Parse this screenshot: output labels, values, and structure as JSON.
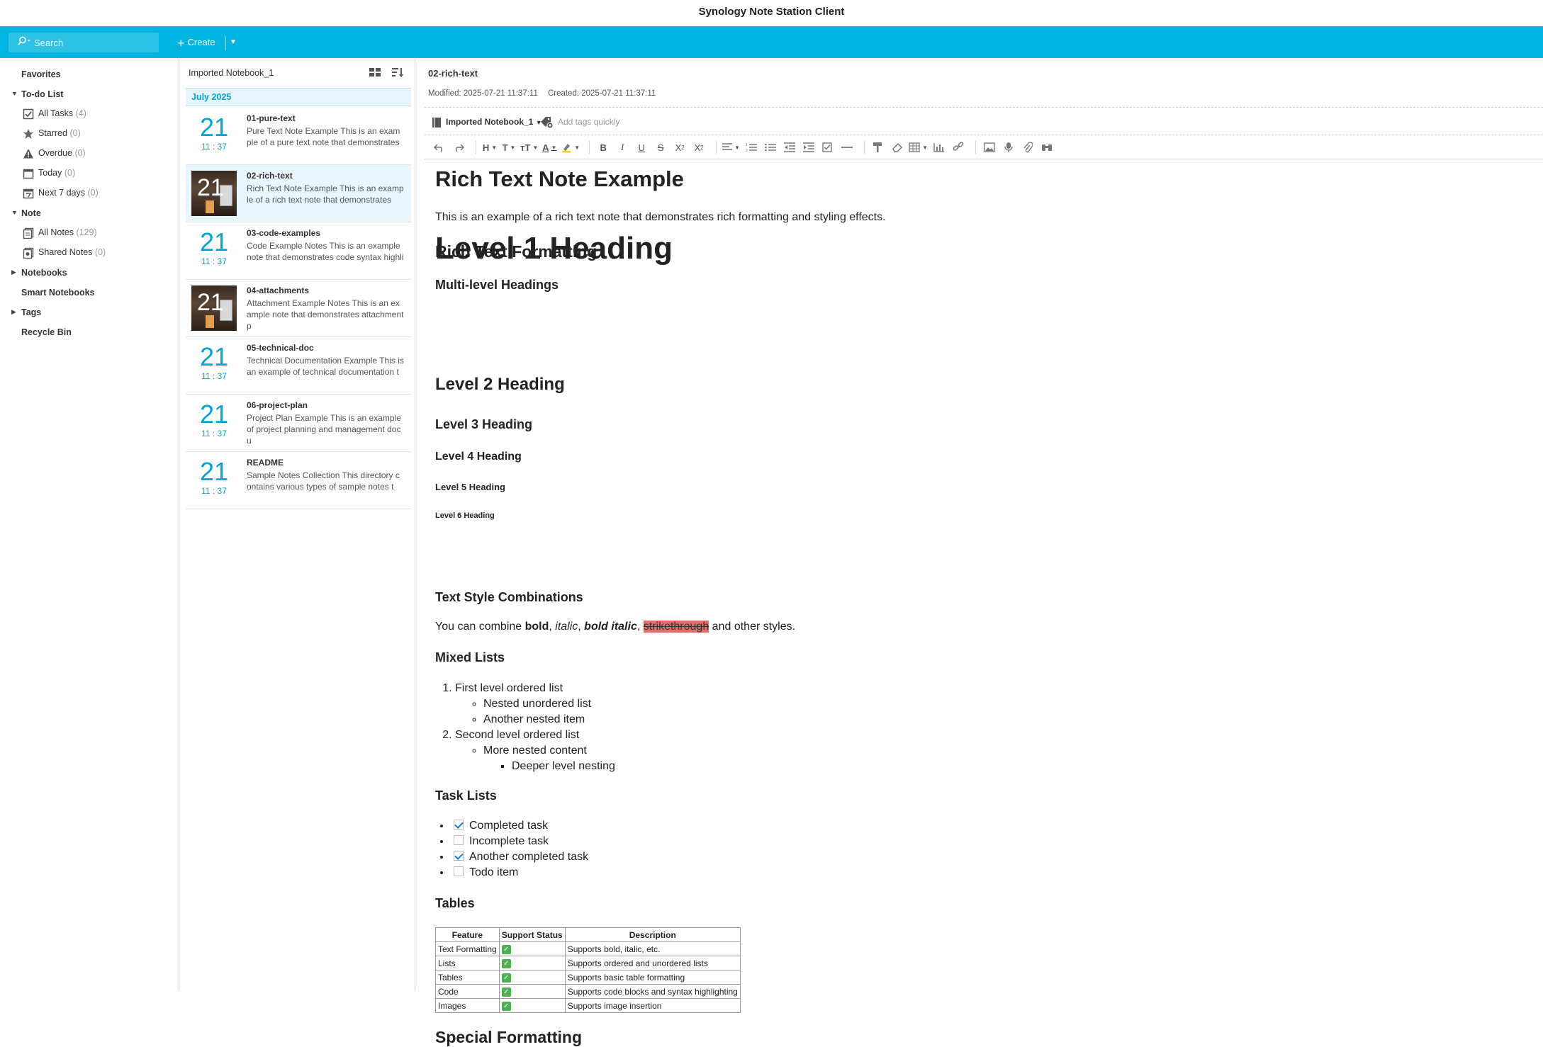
{
  "app": {
    "title": "Synology Note Station Client"
  },
  "topbar": {
    "search_placeholder": "Search",
    "create_label": "Create"
  },
  "sidebar": {
    "favorites": "Favorites",
    "todo": {
      "label": "To-do List",
      "items": [
        {
          "label": "All Tasks",
          "count": "(4)",
          "icon": "checkbox-icon"
        },
        {
          "label": "Starred",
          "count": "(0)",
          "icon": "star-icon"
        },
        {
          "label": "Overdue",
          "count": "(0)",
          "icon": "warning-icon"
        },
        {
          "label": "Today",
          "count": "(0)",
          "icon": "calendar-icon"
        },
        {
          "label": "Next 7 days",
          "count": "(0)",
          "icon": "calendar-week-icon"
        }
      ]
    },
    "note": {
      "label": "Note",
      "items": [
        {
          "label": "All Notes",
          "count": "(129)",
          "icon": "notes-icon"
        },
        {
          "label": "Shared Notes",
          "count": "(0)",
          "icon": "shared-notes-icon"
        }
      ]
    },
    "notebooks": "Notebooks",
    "smart_notebooks": "Smart Notebooks",
    "tags": "Tags",
    "recycle_bin": "Recycle Bin"
  },
  "notelist": {
    "title": "Imported Notebook_1",
    "month": "July 2025",
    "notes": [
      {
        "day": "21",
        "time": "11 : 37",
        "title": "01-pure-text",
        "snippet": "Pure Text Note Example This is an example of a pure text note that demonstrates",
        "thumb": false
      },
      {
        "day": "21",
        "time": "",
        "title": "02-rich-text",
        "snippet": "Rich Text Note Example This is an example of a rich text note that demonstrates",
        "thumb": true
      },
      {
        "day": "21",
        "time": "11 : 37",
        "title": "03-code-examples",
        "snippet": "Code Example Notes This is an example note that demonstrates code syntax highli",
        "thumb": false
      },
      {
        "day": "21",
        "time": "",
        "title": "04-attachments",
        "snippet": "Attachment Example Notes This is an example note that demonstrates attachment p",
        "thumb": true
      },
      {
        "day": "21",
        "time": "11 : 37",
        "title": "05-technical-doc",
        "snippet": "Technical Documentation Example This is an example of technical documentation t",
        "thumb": false
      },
      {
        "day": "21",
        "time": "11 : 37",
        "title": "06-project-plan",
        "snippet": "Project Plan Example This is an example of project planning and management docu",
        "thumb": false
      },
      {
        "day": "21",
        "time": "11 : 37",
        "title": "README",
        "snippet": "Sample Notes Collection This directory contains various types of sample notes t",
        "thumb": false
      }
    ]
  },
  "editor": {
    "title": "02-rich-text",
    "modified": "Modified: 2025-07-21 11:37:11",
    "created": "Created: 2025-07-21 11:37:11",
    "notebook": "Imported Notebook_1",
    "tags_placeholder": "Add tags quickly",
    "content": {
      "h_main": "Rich Text Note Example",
      "intro": "This is an example of a rich text note that demonstrates rich formatting and styling effects.",
      "h_rtf": "Rich Text Formatting",
      "h_multi": "Multi-level Headings",
      "lvl1": "Level 1 Heading",
      "lvl2": "Level 2 Heading",
      "lvl3": "Level 3 Heading",
      "lvl4": "Level 4 Heading",
      "lvl5": "Level 5 Heading",
      "lvl6": "Level 6 Heading",
      "h_styles": "Text Style Combinations",
      "combo": {
        "pre": "You can combine ",
        "bold": "bold",
        "c1": ", ",
        "italic": "italic",
        "c2": ", ",
        "bolditalic": "bold italic",
        "c3": ", ",
        "strike": "strikethrough",
        "post": " and other styles."
      },
      "h_lists": "Mixed Lists",
      "list": {
        "ol1": "First level ordered list",
        "ul1a": "Nested unordered list",
        "ul1b": "Another nested item",
        "ol2": "Second level ordered list",
        "ul2a": "More nested content",
        "ul2b": "Deeper level nesting"
      },
      "h_tasks": "Task Lists",
      "tasks": [
        {
          "label": "Completed task",
          "done": true
        },
        {
          "label": "Incomplete task",
          "done": false
        },
        {
          "label": "Another completed task",
          "done": true
        },
        {
          "label": "Todo item",
          "done": false
        }
      ],
      "h_tables": "Tables",
      "table": {
        "headers": [
          "Feature",
          "Support Status",
          "Description"
        ],
        "rows": [
          [
            "Text Formatting",
            "✅",
            "Supports bold, italic, etc."
          ],
          [
            "Lists",
            "✅",
            "Supports ordered and unordered lists"
          ],
          [
            "Tables",
            "✅",
            "Supports basic table formatting"
          ],
          [
            "Code",
            "✅",
            "Supports code blocks and syntax highlighting"
          ],
          [
            "Images",
            "✅",
            "Supports image insertion"
          ]
        ]
      },
      "h_special": "Special Formatting"
    }
  },
  "colors": {
    "accent": "#00b5e2",
    "date": "#00a5d5",
    "strike_bg": "#e96b6b"
  }
}
